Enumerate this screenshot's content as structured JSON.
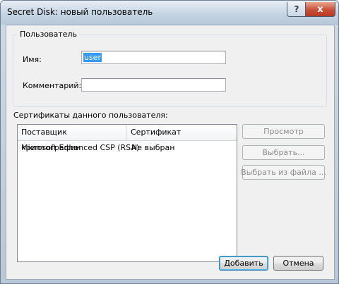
{
  "window": {
    "title": "Secret Disk: новый пользователь"
  },
  "titlebar": {
    "help_glyph": "?",
    "close_glyph": "x"
  },
  "user_group": {
    "legend": "Пользователь",
    "name_label": "Имя:",
    "name_value": "user",
    "comment_label": "Комментарий:",
    "comment_value": ""
  },
  "certificates": {
    "label": "Сертификаты данного пользователя:",
    "columns": [
      "Поставщик криптографии",
      "Сертификат"
    ],
    "rows": [
      [
        "Microsoft Enhanced CSP (RSA)",
        "Не выбран"
      ]
    ]
  },
  "buttons": {
    "view": "Просмотр",
    "choose": "Выбрать...",
    "choose_from_file": "Выбрать из файла ...",
    "add": "Добавить",
    "cancel": "Отмена"
  }
}
